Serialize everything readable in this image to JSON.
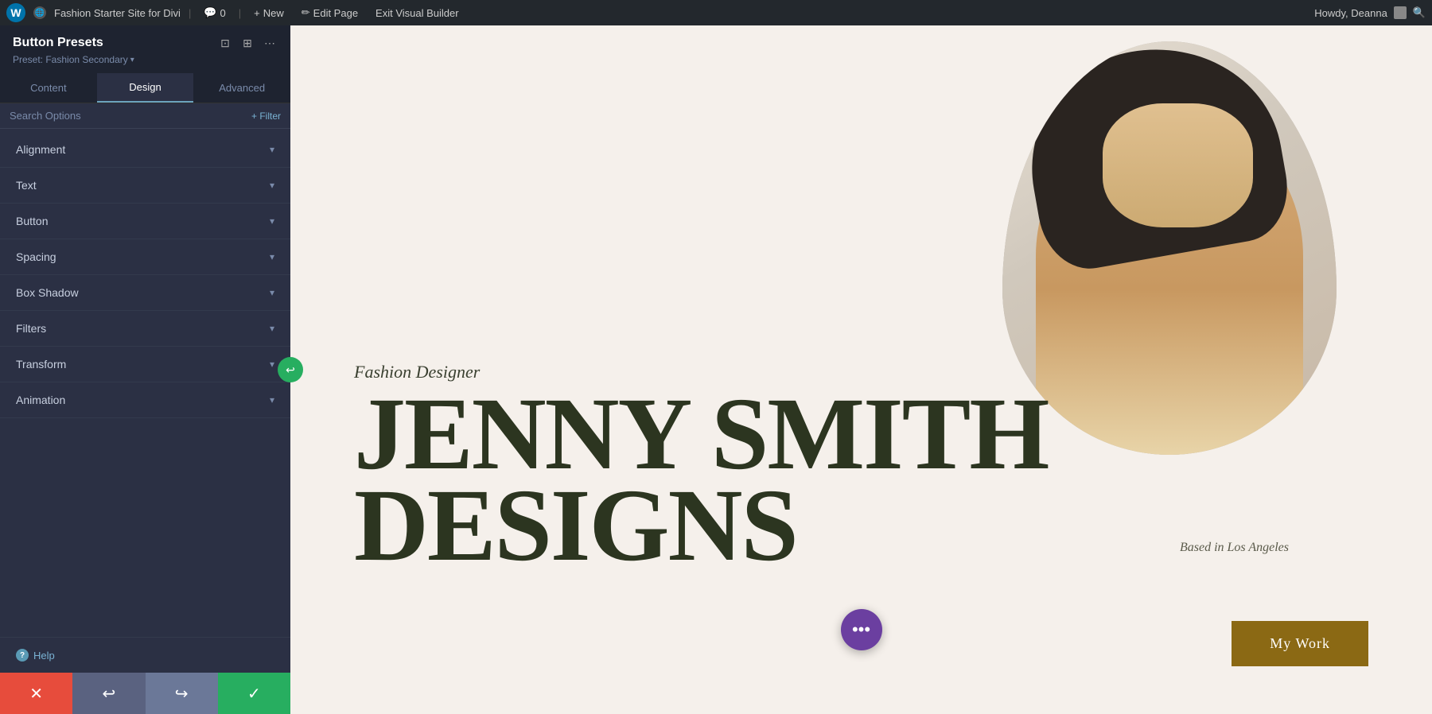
{
  "topbar": {
    "wp_logo": "W",
    "site_icon_label": "🌐",
    "site_name": "Fashion Starter Site for Divi",
    "comments_label": "💬",
    "comments_count": "0",
    "new_label": "New",
    "edit_page_label": "Edit Page",
    "exit_builder_label": "Exit Visual Builder",
    "howdy_text": "Howdy, Deanna",
    "search_icon": "🔍"
  },
  "sidebar": {
    "title": "Button Presets",
    "preset_label": "Preset: Fashion Secondary",
    "preset_arrow": "▾",
    "icon_responsive": "⊡",
    "icon_layout": "⊞",
    "icon_more": "⋯",
    "back_icon": "↩",
    "tabs": [
      {
        "label": "Content",
        "id": "content"
      },
      {
        "label": "Design",
        "id": "design",
        "active": true
      },
      {
        "label": "Advanced",
        "id": "advanced"
      }
    ],
    "search_placeholder": "Search Options",
    "filter_label": "+ Filter",
    "options": [
      {
        "label": "Alignment",
        "id": "alignment"
      },
      {
        "label": "Text",
        "id": "text"
      },
      {
        "label": "Button",
        "id": "button"
      },
      {
        "label": "Spacing",
        "id": "spacing"
      },
      {
        "label": "Box Shadow",
        "id": "box-shadow"
      },
      {
        "label": "Filters",
        "id": "filters"
      },
      {
        "label": "Transform",
        "id": "transform"
      },
      {
        "label": "Animation",
        "id": "animation"
      }
    ],
    "help_label": "Help",
    "help_icon": "?",
    "toolbar": {
      "cancel_icon": "✕",
      "undo_icon": "↩",
      "redo_icon": "↪",
      "save_icon": "✓"
    }
  },
  "canvas": {
    "subtitle": "Fashion Designer",
    "title_line1": "JENNY SMITH",
    "title_line2": "DESIGNS",
    "location": "Based in Los Angeles",
    "my_work_label": "My Work",
    "fab_icon": "•••"
  }
}
